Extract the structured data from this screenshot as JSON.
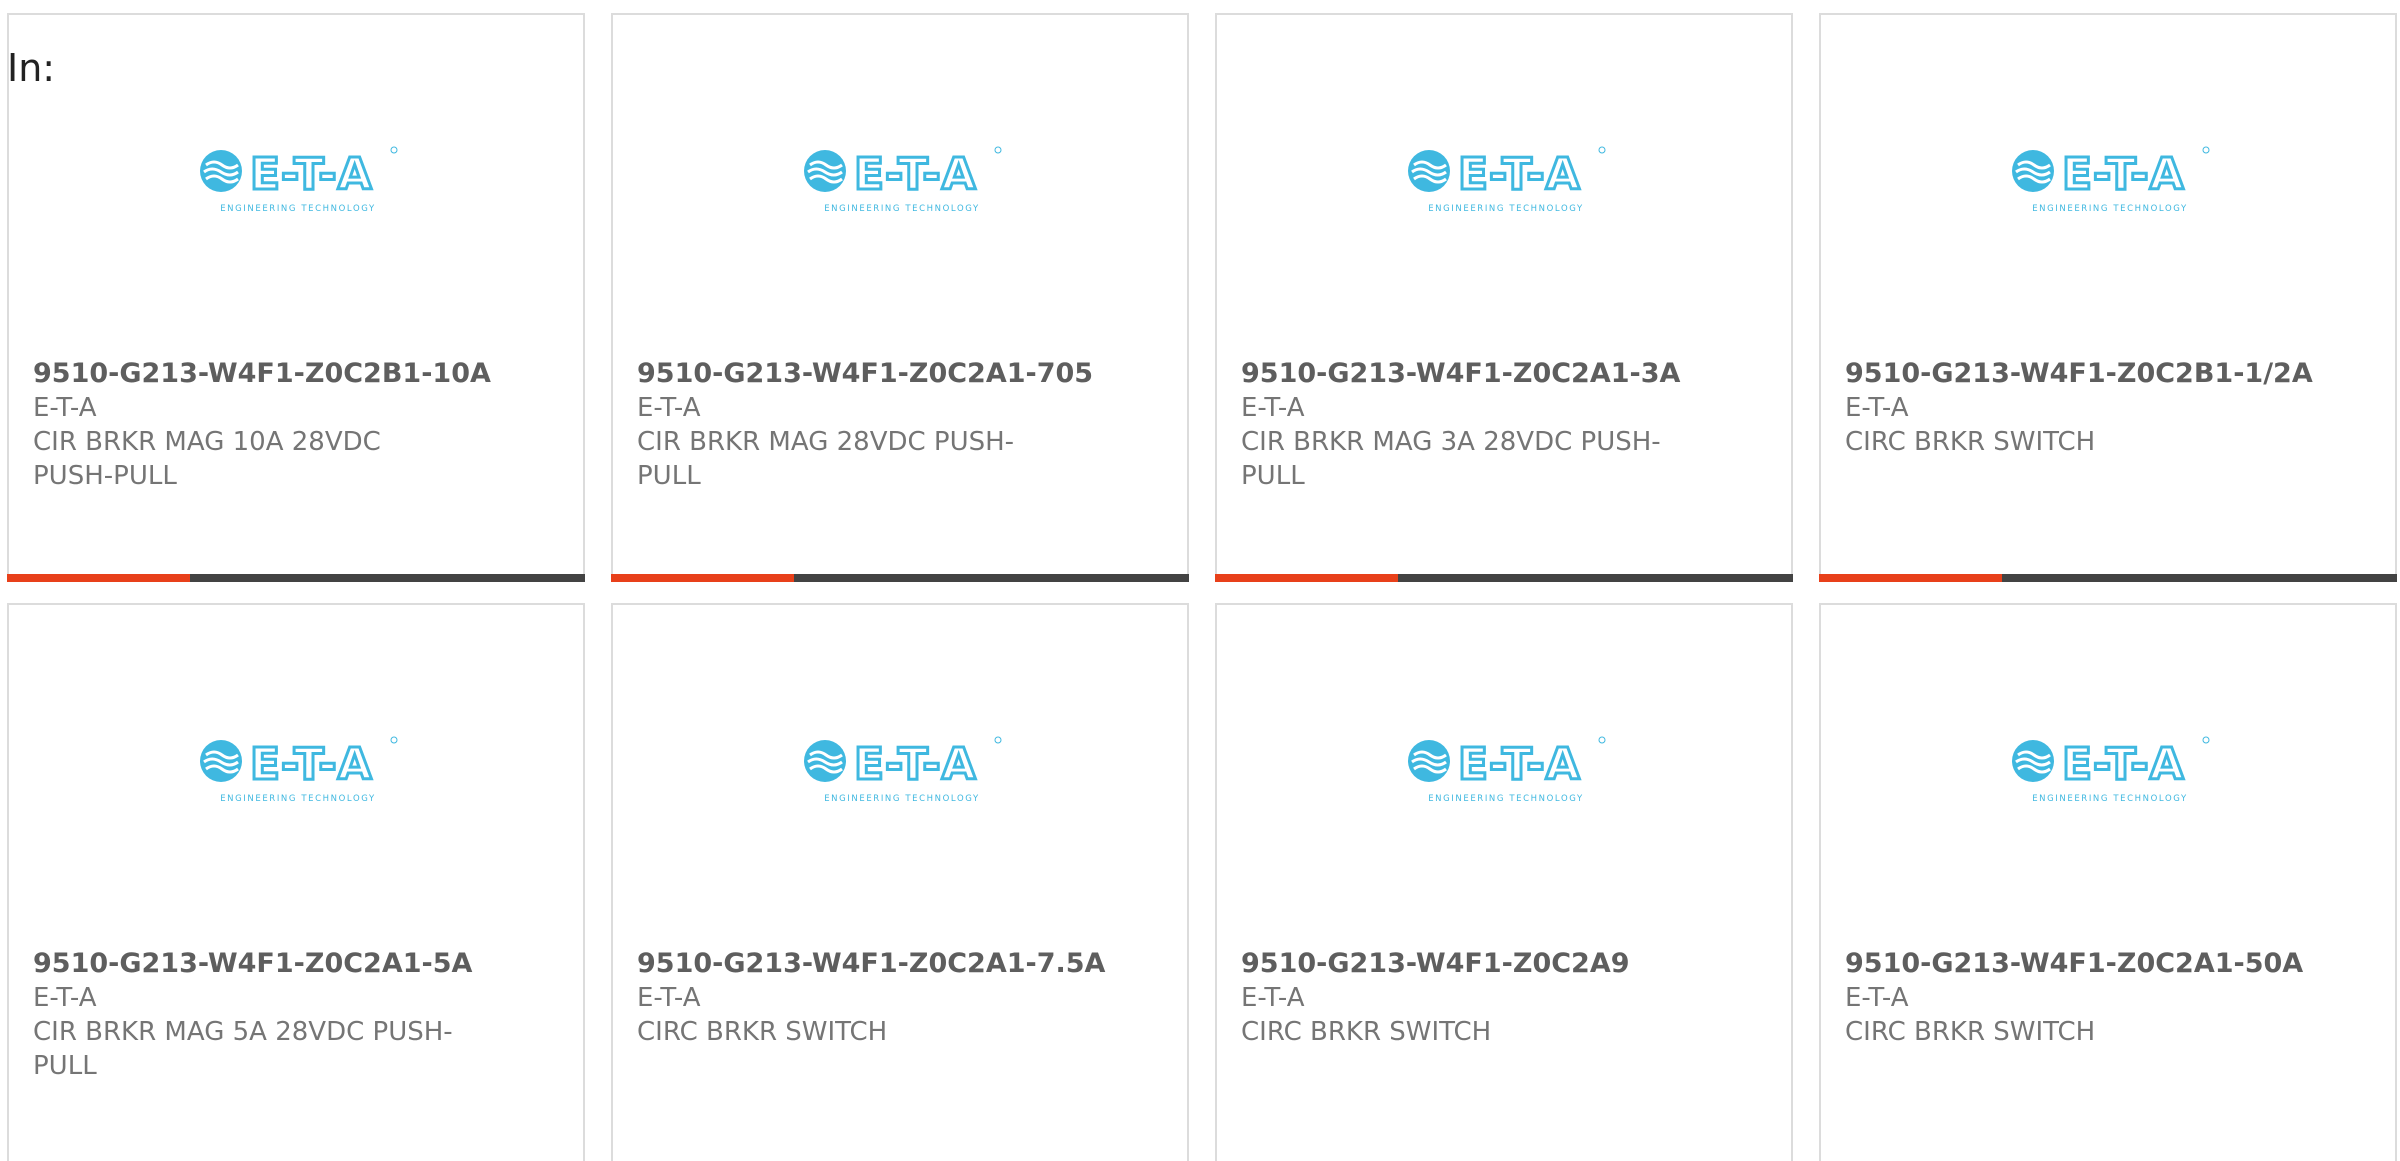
{
  "filter": {
    "label": "In:"
  },
  "colors": {
    "accent": "#e8401a",
    "bar": "#434343",
    "logo": "#3fb8e0"
  },
  "brand_logo": {
    "text": "E-T-A",
    "tagline": "ENGINEERING TECHNOLOGY",
    "icon": "eta-logo-icon"
  },
  "products": [
    {
      "part": "9510-G213-W4F1-Z0C2B1-10A",
      "manufacturer": "E-T-A",
      "description": "CIR BRKR MAG 10A 28VDC PUSH-PULL"
    },
    {
      "part": "9510-G213-W4F1-Z0C2A1-705",
      "manufacturer": "E-T-A",
      "description": "CIR BRKR MAG 28VDC PUSH-PULL"
    },
    {
      "part": "9510-G213-W4F1-Z0C2A1-3A",
      "manufacturer": "E-T-A",
      "description": "CIR BRKR MAG 3A 28VDC PUSH-PULL"
    },
    {
      "part": "9510-G213-W4F1-Z0C2B1-1/2A",
      "manufacturer": "E-T-A",
      "description": "CIRC BRKR SWITCH"
    },
    {
      "part": "9510-G213-W4F1-Z0C2A1-5A",
      "manufacturer": "E-T-A",
      "description": "CIR BRKR MAG 5A 28VDC PUSH-PULL"
    },
    {
      "part": "9510-G213-W4F1-Z0C2A1-7.5A",
      "manufacturer": "E-T-A",
      "description": "CIRC BRKR SWITCH"
    },
    {
      "part": "9510-G213-W4F1-Z0C2A9",
      "manufacturer": "E-T-A",
      "description": "CIRC BRKR SWITCH"
    },
    {
      "part": "9510-G213-W4F1-Z0C2A1-50A",
      "manufacturer": "E-T-A",
      "description": "CIRC BRKR SWITCH"
    }
  ]
}
